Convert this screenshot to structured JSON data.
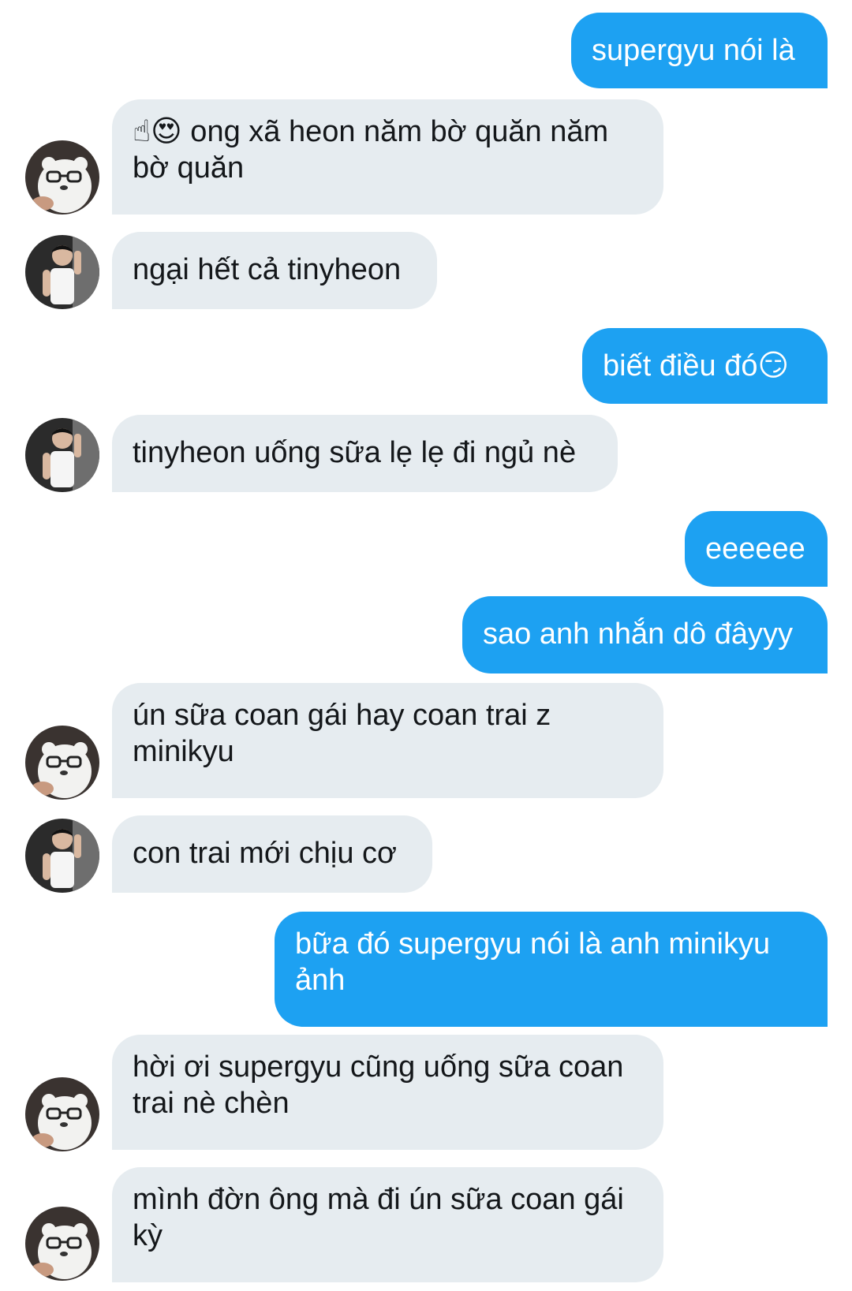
{
  "conversation": {
    "messages": [
      {
        "side": "out",
        "text": "supergyu nói là"
      },
      {
        "side": "in",
        "avatar": "bear-avatar",
        "text": "☝😍 ong xã heon năm bờ quăn năm bờ quăn"
      },
      {
        "side": "in",
        "avatar": "man-avatar",
        "text": "ngại hết cả tinyheon"
      },
      {
        "side": "out",
        "text": "biết điều đó😏"
      },
      {
        "side": "in",
        "avatar": "man-avatar",
        "text": "tinyheon uống sữa lẹ lẹ đi ngủ nè"
      },
      {
        "side": "out",
        "text": "eeeeee"
      },
      {
        "side": "out",
        "text": "sao anh nhắn dô đâyyy"
      },
      {
        "side": "in",
        "avatar": "bear-avatar",
        "text": "ún sữa coan gái hay coan trai z minikyu"
      },
      {
        "side": "in",
        "avatar": "man-avatar",
        "text": "con trai mới chịu cơ"
      },
      {
        "side": "out",
        "text": "bữa đó supergyu nói là anh minikyu ảnh"
      },
      {
        "side": "in",
        "avatar": "bear-avatar",
        "text": "hời ơi supergyu cũng uống sữa coan trai nè chèn"
      },
      {
        "side": "in",
        "avatar": "bear-avatar",
        "text": "mình đờn ông mà đi ún sữa coan gái kỳ"
      }
    ]
  },
  "colors": {
    "outgoing_bubble": "#1da1f2",
    "incoming_bubble": "#e6ecf0",
    "outgoing_text": "#ffffff",
    "incoming_text": "#14171a"
  }
}
